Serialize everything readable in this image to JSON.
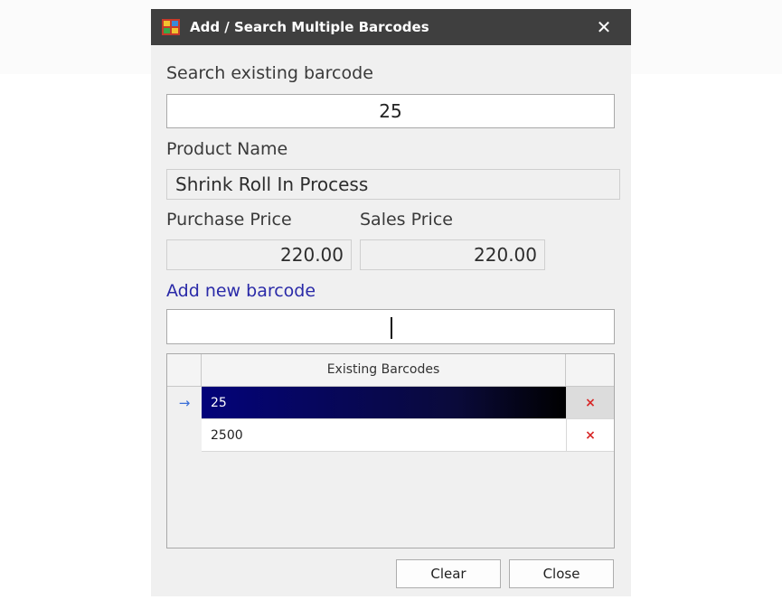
{
  "window": {
    "title": "Add / Search Multiple Barcodes",
    "app_icon": "app-icon",
    "close_label": "✕"
  },
  "search": {
    "label": "Search existing barcode",
    "value": "25"
  },
  "product": {
    "name_label": "Product Name",
    "name_value": "Shrink Roll In Process",
    "purchase_price_label": "Purchase Price",
    "purchase_price_value": "220.00",
    "sales_price_label": "Sales Price",
    "sales_price_value": "220.00"
  },
  "add_barcode": {
    "label": "Add new barcode",
    "value": ""
  },
  "grid": {
    "column_header": "Existing Barcodes",
    "current_row_icon": "→",
    "delete_icon": "×",
    "rows": [
      {
        "barcode": "25",
        "selected": true
      },
      {
        "barcode": "2500",
        "selected": false
      }
    ]
  },
  "buttons": {
    "clear_label": "Clear",
    "close_label": "Close"
  },
  "colors": {
    "titlebar": "#3f3f3f",
    "selection": "#03037a",
    "link_label": "#2a2aa8",
    "delete": "#d82828"
  }
}
